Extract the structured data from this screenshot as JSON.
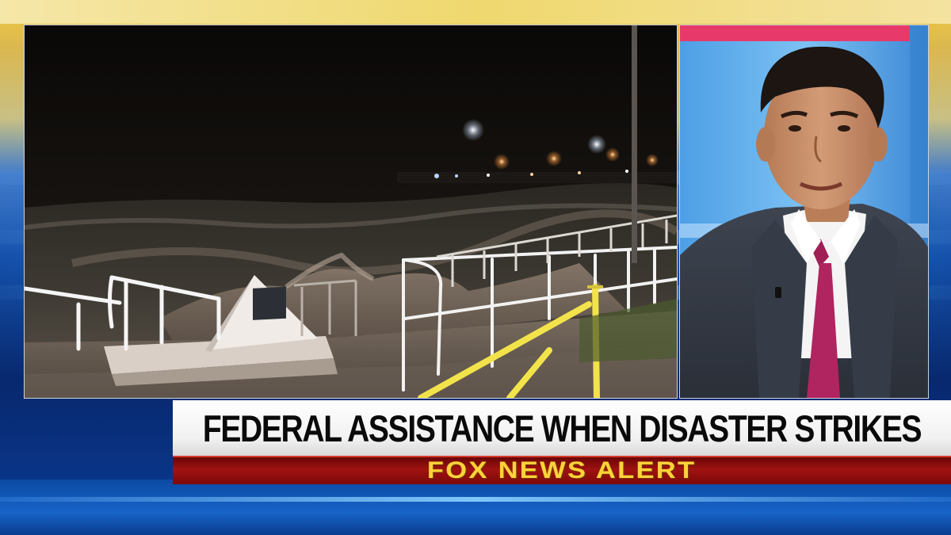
{
  "lower_third": {
    "headline": "FEDERAL ASSISTANCE WHEN DISASTER STRIKES",
    "alert": "FOX NEWS ALERT"
  },
  "colors": {
    "headline_bg": "#ffffff",
    "headline_text": "#0a0a0a",
    "alert_bg": "#a01212",
    "alert_text": "#ffd23a",
    "studio_blue": "#0b4aa3"
  },
  "scene": {
    "left_panel": "storm-surge-seawall-footage",
    "right_panel": "guest-in-studio"
  }
}
